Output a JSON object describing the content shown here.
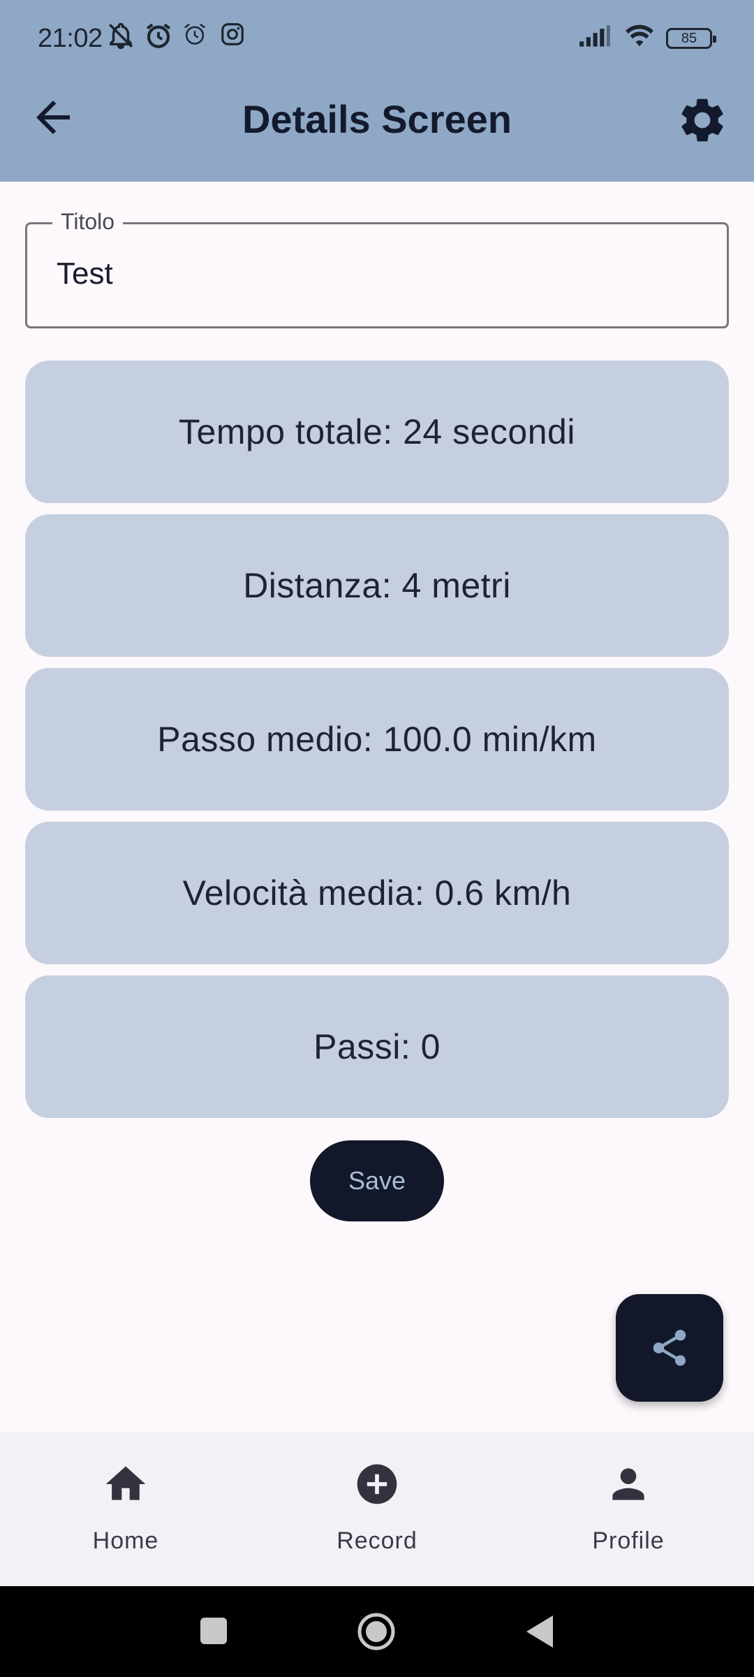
{
  "status_bar": {
    "time": "21:02",
    "battery": "85",
    "left_icons": [
      "bell-off-icon",
      "alarm-icon",
      "alarm-icon",
      "instagram-icon"
    ],
    "right_icons": [
      "signal-icon",
      "wifi-icon",
      "battery-icon"
    ]
  },
  "app_bar": {
    "title": "Details Screen",
    "back_icon": "arrow-left-icon",
    "settings_icon": "gear-icon",
    "color": "#8fa8c5"
  },
  "title_field": {
    "label": "Titolo",
    "value": "Test"
  },
  "stats": [
    {
      "text": "Tempo totale: 24 secondi"
    },
    {
      "text": "Distanza: 4 metri"
    },
    {
      "text": "Passo medio: 100.0 min/km"
    },
    {
      "text": "Velocità media: 0.6 km/h"
    },
    {
      "text": "Passi: 0"
    }
  ],
  "save_button": {
    "label": "Save"
  },
  "fab": {
    "icon": "share-icon"
  },
  "bottom_nav": {
    "items": [
      {
        "label": "Home",
        "icon": "home-icon"
      },
      {
        "label": "Record",
        "icon": "add-circle-icon"
      },
      {
        "label": "Profile",
        "icon": "person-icon"
      }
    ]
  },
  "system_nav": {
    "icons": [
      "recents-square-icon",
      "home-circle-icon",
      "back-triangle-icon"
    ]
  },
  "colors": {
    "card": "#c5cfdf",
    "dark_button": "#121829",
    "background": "#fdf8fc"
  }
}
